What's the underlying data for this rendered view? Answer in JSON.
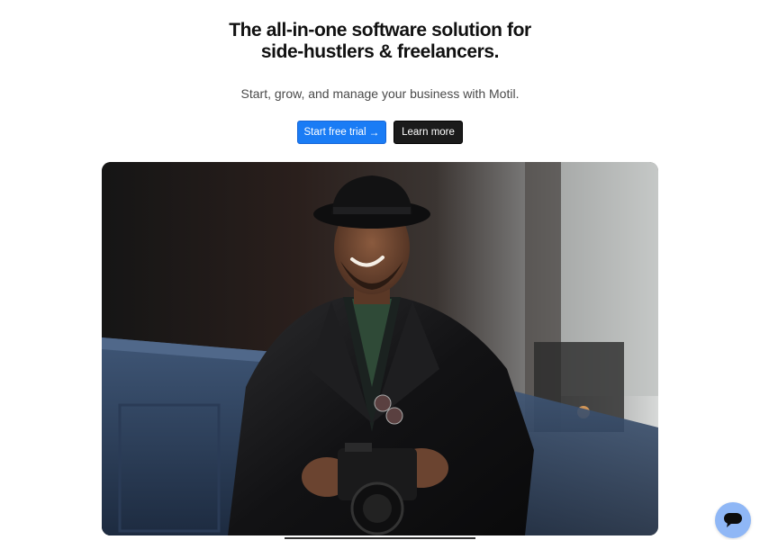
{
  "hero": {
    "headline_line1": "The all-in-one software solution for",
    "headline_line2": "side-hustlers & freelancers.",
    "subheadline": "Start, grow, and manage your business with Motil.",
    "primary_cta_label": "Start free trial",
    "primary_cta_icon": "arrow-right-icon",
    "secondary_cta_label": "Learn more",
    "image_alt": "Smiling man in black hat and leather jacket holding a camera"
  },
  "colors": {
    "primary": "#1a7cf5",
    "secondary": "#1b1b1b",
    "chat": "#8fb7f6"
  },
  "chat": {
    "icon": "chat-bubble-icon"
  }
}
